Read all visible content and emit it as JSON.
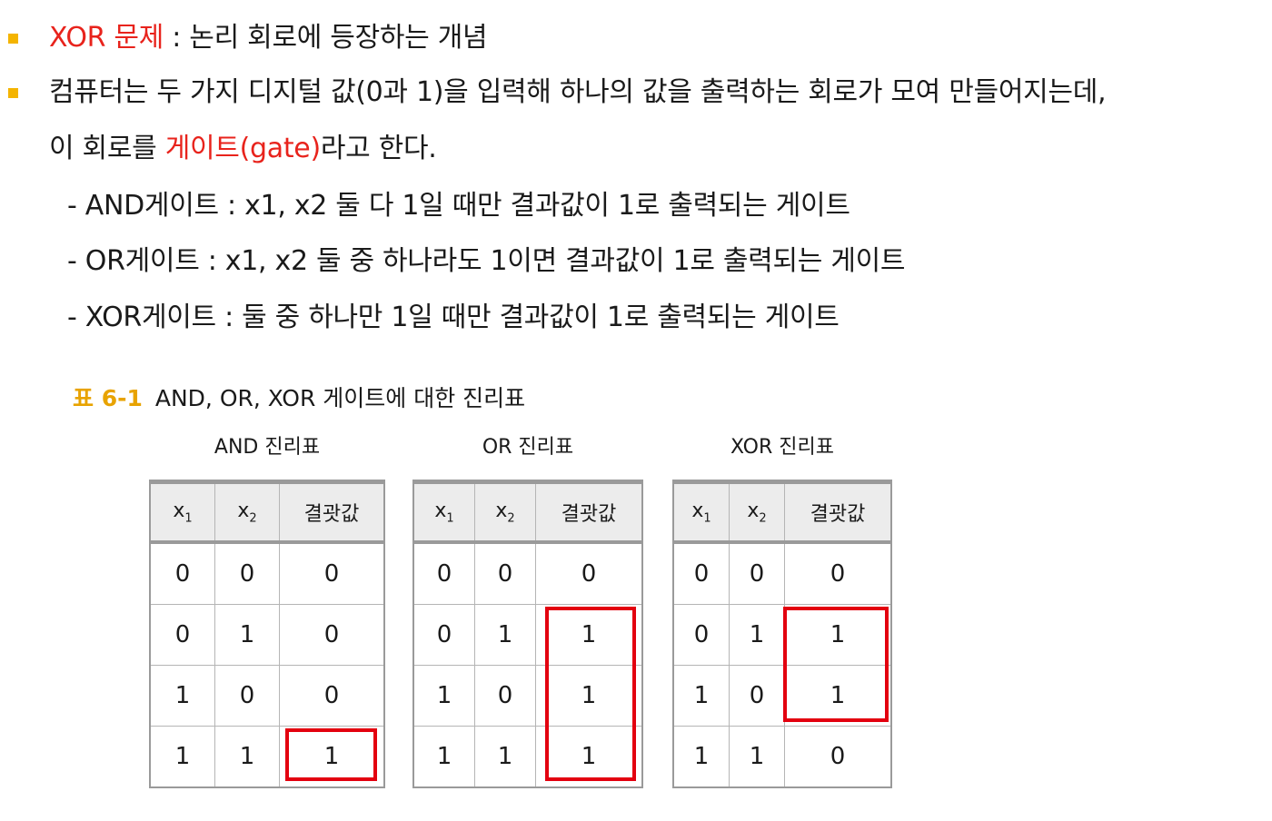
{
  "bullets": [
    {
      "red_part": "XOR 문제",
      "rest": " : 논리 회로에 등장하는 개념"
    },
    {
      "line1": "컴퓨터는 두 가지 디지털 값(0과 1)을 입력해 하나의 값을 출력하는 회로가 모여 만들어지는데,",
      "line2_pre": "이 회로를 ",
      "line2_red": "게이트(gate)",
      "line2_post": "라고 한다."
    }
  ],
  "sub_items": [
    "- AND게이트 : x1, x2 둘 다 1일 때만 결과값이 1로 출력되는 게이트",
    "- OR게이트 : x1, x2 둘 중 하나라도 1이면 결과값이 1로 출력되는 게이트",
    "- XOR게이트 : 둘 중 하나만 1일 때만 결과값이 1로 출력되는 게이트"
  ],
  "caption": {
    "number": "표 6-1",
    "text": "AND, OR, XOR 게이트에 대한 진리표"
  },
  "tables": {
    "headers": {
      "x": "x",
      "x1_sub": "1",
      "x2_sub": "2",
      "result": "결괏값"
    },
    "and": {
      "title": "AND 진리표",
      "rows": [
        [
          "0",
          "0",
          "0"
        ],
        [
          "0",
          "1",
          "0"
        ],
        [
          "1",
          "0",
          "0"
        ],
        [
          "1",
          "1",
          "1"
        ]
      ]
    },
    "or": {
      "title": "OR 진리표",
      "rows": [
        [
          "0",
          "0",
          "0"
        ],
        [
          "0",
          "1",
          "1"
        ],
        [
          "1",
          "0",
          "1"
        ],
        [
          "1",
          "1",
          "1"
        ]
      ]
    },
    "xor": {
      "title": "XOR 진리표",
      "rows": [
        [
          "0",
          "0",
          "0"
        ],
        [
          "0",
          "1",
          "1"
        ],
        [
          "1",
          "0",
          "1"
        ],
        [
          "1",
          "1",
          "0"
        ]
      ]
    }
  },
  "colors": {
    "accent_red": "#e8231c",
    "bullet_yellow": "#f4b400",
    "caption_orange": "#e8a300"
  }
}
